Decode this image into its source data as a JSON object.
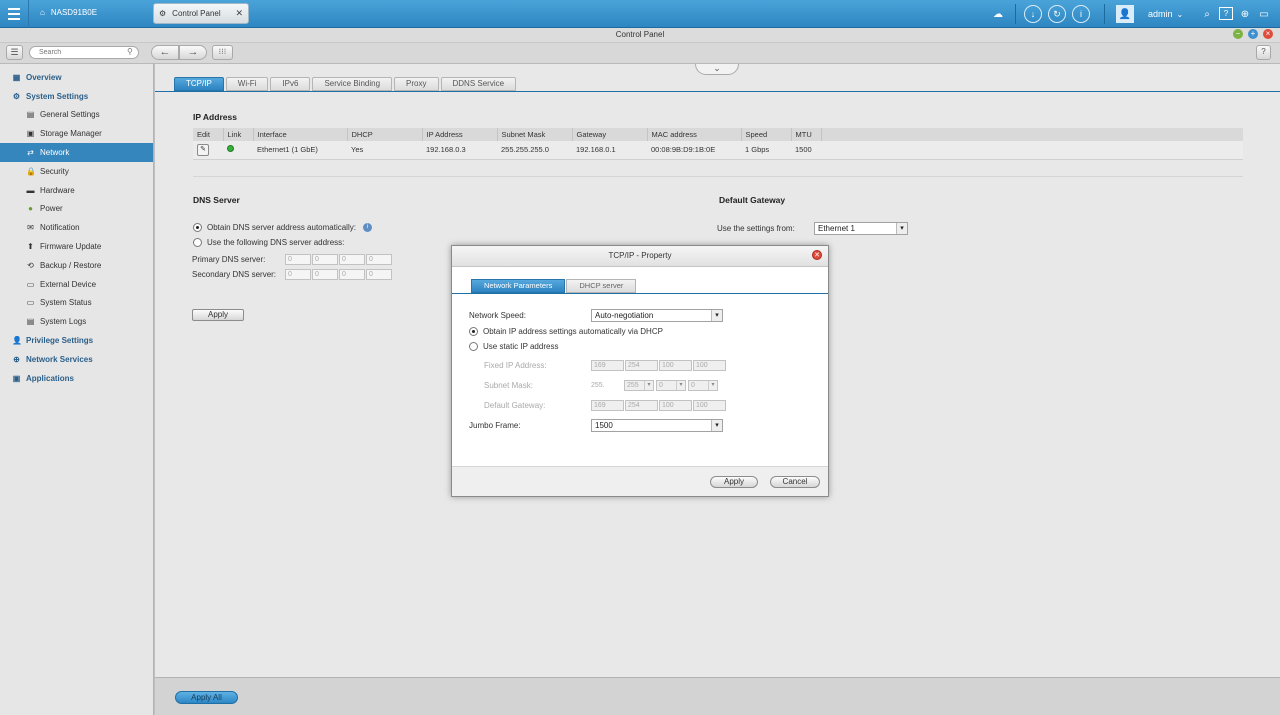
{
  "topbar": {
    "nas_name": "NASD91B0E",
    "tab_label": "Control Panel",
    "user": "admin",
    "user_caret": "⌄",
    "menu_icon": "hamburger-icon",
    "home_icon": "home-icon",
    "control_panel_icon": "gear-icon",
    "tab_close_icon": "close-icon",
    "tray_icons": [
      "cloud-icon",
      "download-icon",
      "sync-icon",
      "info-icon",
      "user-icon",
      "search-icon",
      "help-icon",
      "globe-icon",
      "monitor-icon"
    ],
    "brand_color": "#3a93cf"
  },
  "window": {
    "title": "Control Panel",
    "help": "?"
  },
  "toolbar": {
    "search_placeholder": "Search",
    "back": "←",
    "forward": "→"
  },
  "sidebar": {
    "overview": "Overview",
    "system_settings": "System Settings",
    "items": [
      "General Settings",
      "Storage Manager",
      "Network",
      "Security",
      "Hardware",
      "Power",
      "Notification",
      "Firmware Update",
      "Backup / Restore",
      "External Device",
      "System Status",
      "System Logs"
    ],
    "privilege_settings": "Privilege Settings",
    "network_services": "Network Services",
    "applications": "Applications",
    "active_color": "#3486bd"
  },
  "tabs": [
    "TCP/IP",
    "Wi-Fi",
    "IPv6",
    "Service Binding",
    "Proxy",
    "DDNS Service"
  ],
  "ip_address": {
    "title": "IP Address",
    "columns": [
      "Edit",
      "Link",
      "Interface",
      "DHCP",
      "IP Address",
      "Subnet Mask",
      "Gateway",
      "MAC address",
      "Speed",
      "MTU"
    ],
    "row": {
      "interface": "Ethernet1 (1 GbE)",
      "dhcp": "Yes",
      "ip": "192.168.0.3",
      "mask": "255.255.255.0",
      "gateway": "192.168.0.1",
      "mac": "00:08:9B:D9:1B:0E",
      "speed": "1 Gbps",
      "mtu": "1500",
      "link_status_color": "#37b03a"
    }
  },
  "dns": {
    "title": "DNS Server",
    "auto": "Obtain DNS server address automatically:",
    "manual": "Use the following DNS server address:",
    "primary": "Primary DNS server:",
    "secondary": "Secondary DNS server:",
    "octet": "0",
    "apply": "Apply"
  },
  "gateway": {
    "title": "Default Gateway",
    "label": "Use the settings from:",
    "value": "Ethernet 1"
  },
  "dialog": {
    "title": "TCP/IP - Property",
    "tabs": [
      "Network Parameters",
      "DHCP server"
    ],
    "network_speed_label": "Network Speed:",
    "network_speed_value": "Auto-negotiation",
    "dhcp_option": "Obtain IP address settings automatically via DHCP",
    "static_option": "Use static IP address",
    "fixed_ip_label": "Fixed IP Address:",
    "fixed_ip": [
      "169",
      "254",
      "100",
      "100"
    ],
    "subnet_label": "Subnet Mask:",
    "subnet": [
      "255.",
      "255",
      "0",
      "0"
    ],
    "gateway_label": "Default Gateway:",
    "gateway": [
      "169",
      "254",
      "100",
      "100"
    ],
    "jumbo_label": "Jumbo Frame:",
    "jumbo_value": "1500",
    "apply": "Apply",
    "cancel": "Cancel"
  },
  "footer": {
    "apply_all": "Apply All"
  }
}
